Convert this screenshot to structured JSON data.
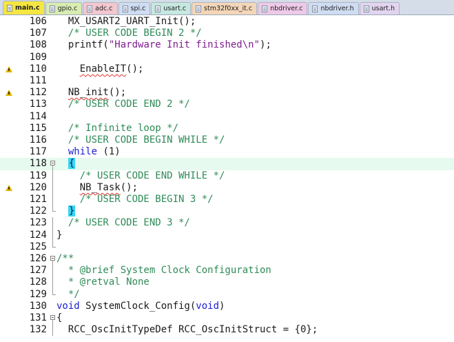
{
  "tabs": [
    {
      "label": "main.c",
      "active": true,
      "color": "#f5e642"
    },
    {
      "label": "gpio.c",
      "active": false,
      "color": "#d9ecb2"
    },
    {
      "label": "adc.c",
      "active": false,
      "color": "#f2c7cf"
    },
    {
      "label": "spi.c",
      "active": false,
      "color": "#cfdcf2"
    },
    {
      "label": "usart.c",
      "active": false,
      "color": "#c6e8df"
    },
    {
      "label": "stm32f0xx_it.c",
      "active": false,
      "color": "#f4d6b8"
    },
    {
      "label": "nbdriver.c",
      "active": false,
      "color": "#eec9e8"
    },
    {
      "label": "nbdriver.h",
      "active": false,
      "color": "#cfdcf2"
    },
    {
      "label": "usart.h",
      "active": false,
      "color": "#e2d4ef"
    }
  ],
  "editor": {
    "current_line": "118",
    "lines": [
      {
        "num": "106",
        "warn": false,
        "indent": "  ",
        "parts": [
          {
            "t": "MX_USART2_UART_Init();"
          }
        ]
      },
      {
        "num": "107",
        "warn": false,
        "indent": "  ",
        "parts": [
          {
            "t": "/* USER CODE BEGIN 2 */",
            "c": "cmt"
          }
        ]
      },
      {
        "num": "108",
        "warn": false,
        "indent": "  ",
        "parts": [
          {
            "t": "printf("
          },
          {
            "t": "\"Hardware Init finished\\n\"",
            "c": "str"
          },
          {
            "t": ");"
          }
        ]
      },
      {
        "num": "109",
        "warn": false,
        "indent": "",
        "parts": []
      },
      {
        "num": "110",
        "warn": true,
        "indent": "    ",
        "parts": [
          {
            "t": "EnableIT",
            "c": "squig"
          },
          {
            "t": "();"
          }
        ]
      },
      {
        "num": "111",
        "warn": false,
        "indent": "",
        "parts": []
      },
      {
        "num": "112",
        "warn": true,
        "indent": "  ",
        "parts": [
          {
            "t": "NB_init",
            "c": "squig"
          },
          {
            "t": "();"
          }
        ]
      },
      {
        "num": "113",
        "warn": false,
        "indent": "  ",
        "parts": [
          {
            "t": "/* USER CODE END 2 */",
            "c": "cmt"
          }
        ]
      },
      {
        "num": "114",
        "warn": false,
        "indent": "",
        "parts": []
      },
      {
        "num": "115",
        "warn": false,
        "indent": "  ",
        "parts": [
          {
            "t": "/* Infinite loop */",
            "c": "cmt"
          }
        ]
      },
      {
        "num": "116",
        "warn": false,
        "indent": "  ",
        "parts": [
          {
            "t": "/* USER CODE BEGIN WHILE */",
            "c": "cmt"
          }
        ]
      },
      {
        "num": "117",
        "warn": false,
        "indent": "  ",
        "parts": [
          {
            "t": "while",
            "c": "kw"
          },
          {
            "t": " (1)"
          }
        ]
      },
      {
        "num": "118",
        "warn": false,
        "indent": "  ",
        "fold": true,
        "parts": [
          {
            "t": "{",
            "c": "brace"
          }
        ]
      },
      {
        "num": "119",
        "warn": false,
        "indent": "    ",
        "guide": true,
        "parts": [
          {
            "t": "/* USER CODE END WHILE */",
            "c": "cmt"
          }
        ]
      },
      {
        "num": "120",
        "warn": true,
        "indent": "    ",
        "guide": true,
        "parts": [
          {
            "t": "NB_Task",
            "c": "squig"
          },
          {
            "t": "();"
          }
        ]
      },
      {
        "num": "121",
        "warn": false,
        "indent": "    ",
        "guide": true,
        "parts": [
          {
            "t": "/* USER CODE BEGIN 3 */",
            "c": "cmt"
          }
        ]
      },
      {
        "num": "122",
        "warn": false,
        "indent": "  ",
        "end": true,
        "parts": [
          {
            "t": "}",
            "c": "brace"
          }
        ]
      },
      {
        "num": "123",
        "warn": false,
        "indent": "  ",
        "guide": true,
        "parts": [
          {
            "t": "/* USER CODE END 3 */",
            "c": "cmt"
          }
        ]
      },
      {
        "num": "124",
        "warn": false,
        "indent": "",
        "guide": true,
        "parts": [
          {
            "t": "}"
          }
        ]
      },
      {
        "num": "125",
        "warn": false,
        "indent": "",
        "end": true,
        "parts": []
      },
      {
        "num": "126",
        "warn": false,
        "indent": "",
        "fold": true,
        "parts": [
          {
            "t": "/**",
            "c": "cmt"
          }
        ]
      },
      {
        "num": "127",
        "warn": false,
        "indent": "  ",
        "guide": true,
        "parts": [
          {
            "t": "* @brief System Clock Configuration",
            "c": "cmt"
          }
        ]
      },
      {
        "num": "128",
        "warn": false,
        "indent": "  ",
        "guide": true,
        "parts": [
          {
            "t": "* @retval None",
            "c": "cmt"
          }
        ]
      },
      {
        "num": "129",
        "warn": false,
        "indent": "  ",
        "end": true,
        "parts": [
          {
            "t": "*/",
            "c": "cmt"
          }
        ]
      },
      {
        "num": "130",
        "warn": false,
        "indent": "",
        "parts": [
          {
            "t": "void",
            "c": "kw"
          },
          {
            "t": " SystemClock_Config("
          },
          {
            "t": "void",
            "c": "kw"
          },
          {
            "t": ")"
          }
        ]
      },
      {
        "num": "131",
        "warn": false,
        "indent": "",
        "fold": true,
        "parts": [
          {
            "t": "{"
          }
        ]
      },
      {
        "num": "132",
        "warn": false,
        "indent": "  ",
        "guide": true,
        "parts": [
          {
            "t": "RCC_OscInitTypeDef RCC_OscInitStruct = {0};"
          }
        ]
      }
    ]
  }
}
